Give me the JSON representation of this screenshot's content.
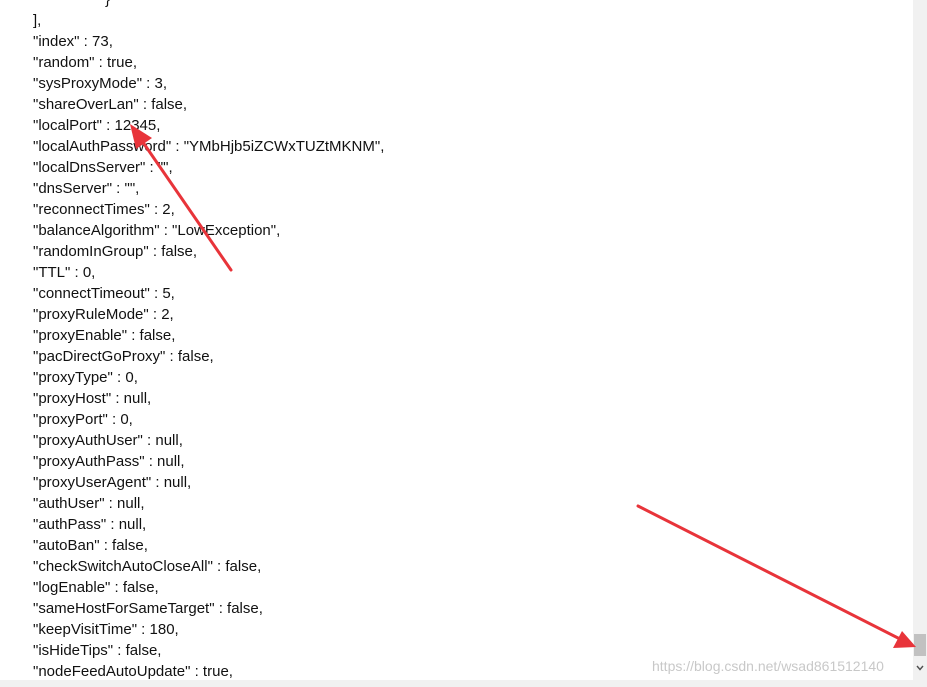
{
  "code_lines": [
    "}",
    "],",
    "\"index\" : 73,",
    "\"random\" : true,",
    "\"sysProxyMode\" : 3,",
    "\"shareOverLan\" : false,",
    "\"localPort\" : 12345,",
    "\"localAuthPassword\" : \"YMbHjb5iZCWxTUZtMKNM\",",
    "\"localDnsServer\" : \"\",",
    "\"dnsServer\" : \"\",",
    "\"reconnectTimes\" : 2,",
    "\"balanceAlgorithm\" : \"LowException\",",
    "\"randomInGroup\" : false,",
    "\"TTL\" : 0,",
    "\"connectTimeout\" : 5,",
    "\"proxyRuleMode\" : 2,",
    "\"proxyEnable\" : false,",
    "\"pacDirectGoProxy\" : false,",
    "\"proxyType\" : 0,",
    "\"proxyHost\" : null,",
    "\"proxyPort\" : 0,",
    "\"proxyAuthUser\" : null,",
    "\"proxyAuthPass\" : null,",
    "\"proxyUserAgent\" : null,",
    "\"authUser\" : null,",
    "\"authPass\" : null,",
    "\"autoBan\" : false,",
    "\"checkSwitchAutoCloseAll\" : false,",
    "\"logEnable\" : false,",
    "\"sameHostForSameTarget\" : false,",
    "\"keepVisitTime\" : 180,",
    "\"isHideTips\" : false,",
    "\"nodeFeedAutoUpdate\" : true,"
  ],
  "watermark": "https://blog.csdn.net/wsad861512140",
  "colors": {
    "annotation_arrow": "#e8343a",
    "text": "#111111",
    "scrollbar_track": "#f1f1f1",
    "scrollbar_thumb": "#c1c1c1"
  },
  "icons": {
    "scroll_down": "chevron-down-icon"
  }
}
